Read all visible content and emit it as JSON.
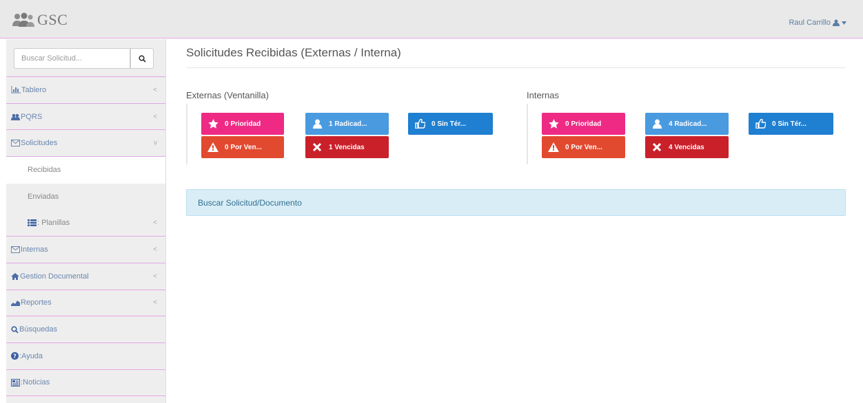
{
  "brand": {
    "name": "GSC"
  },
  "user": {
    "name": "Raul Carrillo"
  },
  "search": {
    "placeholder": "Buscar Solicitud..."
  },
  "sidebar": {
    "items": [
      {
        "label": "Tablero",
        "icon": "bar-chart-icon",
        "chevron": "<"
      },
      {
        "label": "PQRS",
        "icon": "users-icon",
        "chevron": "<"
      },
      {
        "label": "Solicitudes",
        "icon": "envelope-icon",
        "chevron": "v"
      },
      {
        "label": "Internas",
        "icon": "envelope-icon",
        "chevron": "<"
      },
      {
        "label": "Gestion Documental",
        "icon": "home-icon",
        "chevron": "<"
      },
      {
        "label": "Reportes",
        "icon": "area-chart-icon",
        "chevron": "<"
      },
      {
        "label": "Búsquedas",
        "icon": "search-icon"
      },
      {
        "label": ":Ayuda",
        "icon": "question-icon"
      },
      {
        "label": ":Noticias",
        "icon": "newspaper-icon"
      }
    ],
    "sub_items": [
      {
        "label": "Recibidas"
      },
      {
        "label": "Enviadas"
      },
      {
        "label": ": Planillas",
        "icon": "list-icon",
        "chevron": "<"
      }
    ]
  },
  "main": {
    "title": "Solicitudes Recibidas (Externas / Interna)",
    "alert": "Buscar Solicitud/Documento"
  },
  "groups": [
    {
      "title": "Externas (Ventanilla)",
      "tiles": {
        "prioridad": "0 Prioridad",
        "por_vencer": "0 Por Ven...",
        "radicadas": "1 Radicad...",
        "vencidas": "1 Vencidas",
        "sin_termino": "0 Sin Tér..."
      }
    },
    {
      "title": "Internas",
      "tiles": {
        "prioridad": "0 Prioridad",
        "por_vencer": "0 Por Ven...",
        "radicadas": "4 Radicad...",
        "vencidas": "4 Vencidas",
        "sin_termino": "0 Sin Tér..."
      }
    }
  ],
  "colors": {
    "pink": "#ee2a84",
    "orange": "#e24a30",
    "light_blue": "#4a9ae0",
    "red": "#c9202a",
    "blue": "#1f7fd1",
    "divider": "#e3a6e6"
  }
}
